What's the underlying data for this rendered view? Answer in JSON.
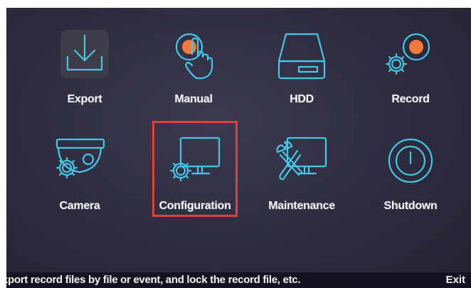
{
  "menu": {
    "items": [
      {
        "label": "Export",
        "icon": "export-icon"
      },
      {
        "label": "Manual",
        "icon": "manual-icon"
      },
      {
        "label": "HDD",
        "icon": "hdd-icon"
      },
      {
        "label": "Record",
        "icon": "record-icon"
      },
      {
        "label": "Camera",
        "icon": "camera-icon"
      },
      {
        "label": "Configuration",
        "icon": "configuration-icon"
      },
      {
        "label": "Maintenance",
        "icon": "maintenance-icon"
      },
      {
        "label": "Shutdown",
        "icon": "shutdown-icon"
      }
    ],
    "selected": "Configuration"
  },
  "statusbar": {
    "description": "xport record files by file or event, and lock the record file, etc.",
    "exit_label": "Exit"
  },
  "colors": {
    "icon_stroke": "#45c6e6",
    "accent_orange": "#f27a3a",
    "selection_border": "#d9443a",
    "background": "#2d2c3f"
  }
}
